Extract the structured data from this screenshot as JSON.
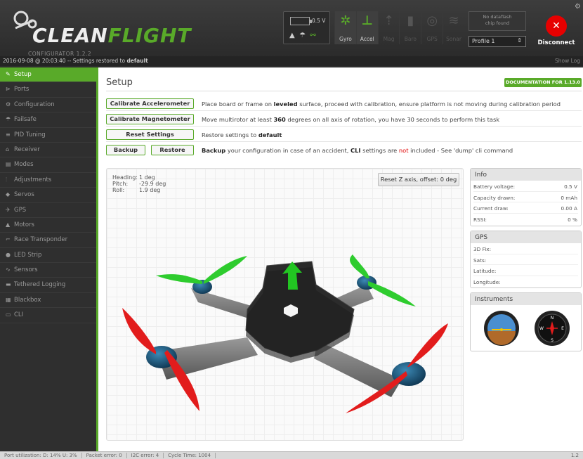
{
  "header": {
    "logo_main": "CLEAN",
    "logo_highlight": "FLIGHT",
    "logo_sub": "CONFIGURATOR 1.2.2",
    "battery_value": "0.5 V",
    "sensors": [
      {
        "label": "Gyro",
        "icon": "gyro-icon",
        "active": true
      },
      {
        "label": "Accel",
        "icon": "accel-icon",
        "active": true
      },
      {
        "label": "Mag",
        "icon": "mag-icon",
        "active": false
      },
      {
        "label": "Baro",
        "icon": "baro-icon",
        "active": false
      },
      {
        "label": "GPS",
        "icon": "gps-icon",
        "active": false
      },
      {
        "label": "Sonar",
        "icon": "sonar-icon",
        "active": false
      }
    ],
    "dataflash_line1": "No dataflash",
    "dataflash_line2": "chip found",
    "profile": "Profile 1",
    "disconnect_label": "Disconnect"
  },
  "log": {
    "message_prefix": "2016-09-08 @ 20:03:40 -- Settings restored to ",
    "message_bold": "default",
    "show_log": "Show Log"
  },
  "sidebar": {
    "items": [
      {
        "label": "Setup",
        "icon": "wrench-icon",
        "glyph": "✎",
        "active": true
      },
      {
        "label": "Ports",
        "icon": "ports-icon",
        "glyph": "⊳"
      },
      {
        "label": "Configuration",
        "icon": "gear-icon",
        "glyph": "⚙"
      },
      {
        "label": "Failsafe",
        "icon": "parachute-icon",
        "glyph": "☂"
      },
      {
        "label": "PID Tuning",
        "icon": "sliders-icon",
        "glyph": "≡"
      },
      {
        "label": "Receiver",
        "icon": "receiver-icon",
        "glyph": "⌂"
      },
      {
        "label": "Modes",
        "icon": "modes-icon",
        "glyph": "▤"
      },
      {
        "label": "Adjustments",
        "icon": "adjust-icon",
        "glyph": "⫶"
      },
      {
        "label": "Servos",
        "icon": "servo-icon",
        "glyph": "◆"
      },
      {
        "label": "GPS",
        "icon": "satellite-icon",
        "glyph": "✈"
      },
      {
        "label": "Motors",
        "icon": "motor-icon",
        "glyph": "▲"
      },
      {
        "label": "Race Transponder",
        "icon": "transponder-icon",
        "glyph": "⌐"
      },
      {
        "label": "LED Strip",
        "icon": "led-icon",
        "glyph": "●"
      },
      {
        "label": "Sensors",
        "icon": "pulse-icon",
        "glyph": "∿"
      },
      {
        "label": "Tethered Logging",
        "icon": "log-icon",
        "glyph": "▬"
      },
      {
        "label": "Blackbox",
        "icon": "blackbox-icon",
        "glyph": "▦"
      },
      {
        "label": "CLI",
        "icon": "terminal-icon",
        "glyph": "▭"
      }
    ]
  },
  "main": {
    "title": "Setup",
    "doc_button": "DOCUMENTATION FOR 1.13.0",
    "calibrate_acc": {
      "label": "Calibrate Accelerometer",
      "text_a": "Place board or frame on ",
      "text_b": "leveled",
      "text_c": " surface, proceed with calibration, ensure platform is not moving during calibration period"
    },
    "calibrate_mag": {
      "label": "Calibrate Magnetometer",
      "text_a": "Move multirotor at least ",
      "text_b": "360",
      "text_c": " degrees on all axis of rotation, you have 30 seconds to perform this task"
    },
    "reset": {
      "label": "Reset Settings",
      "text_a": "Restore settings to ",
      "text_b": "default"
    },
    "backup": {
      "backup_label": "Backup",
      "restore_label": "Restore",
      "text_a": "Backup",
      "text_b": " your configuration in case of an accident, ",
      "text_c": "CLI",
      "text_d": " settings are ",
      "text_e": "not",
      "text_f": " included - See 'dump' cli command"
    },
    "attitude": {
      "heading_label": "Heading:",
      "heading": "1 deg",
      "pitch_label": "Pitch:",
      "pitch": "-29.9 deg",
      "roll_label": "Roll:",
      "roll": "1.9 deg"
    },
    "reset_z": "Reset Z axis, offset: 0 deg"
  },
  "info": {
    "title": "Info",
    "rows": [
      {
        "label": "Battery voltage:",
        "value": "0.5 V"
      },
      {
        "label": "Capacity drawn:",
        "value": "0 mAh"
      },
      {
        "label": "Current draw:",
        "value": "0.00 A"
      },
      {
        "label": "RSSI:",
        "value": "0 %"
      }
    ]
  },
  "gps": {
    "title": "GPS",
    "rows": [
      {
        "label": "3D Fix:",
        "value": ""
      },
      {
        "label": "Sats:",
        "value": ""
      },
      {
        "label": "Latitude:",
        "value": ""
      },
      {
        "label": "Longitude:",
        "value": ""
      }
    ]
  },
  "instruments": {
    "title": "Instruments"
  },
  "footer": {
    "port_util": "Port utilization: D: 14% U: 3%",
    "packet_error": "Packet error: 0",
    "i2c_error": "I2C error: 4",
    "cycle_time": "Cycle Time: 1004",
    "version": "1.2"
  },
  "colors": {
    "accent": "#59aa29",
    "disconnect": "#e60000",
    "prop_front": "#2ecc2e",
    "prop_rear": "#e21c1c"
  }
}
